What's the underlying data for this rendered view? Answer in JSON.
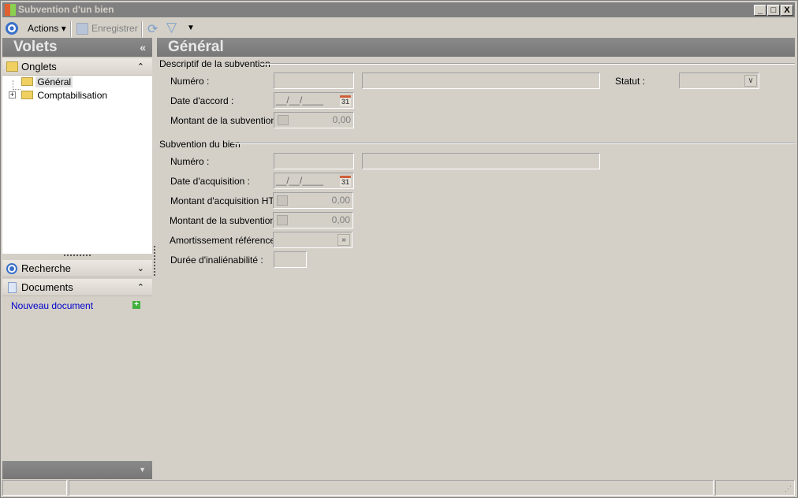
{
  "window": {
    "title": "Subvention d'un bien",
    "min": "_",
    "max": "□",
    "close": "X"
  },
  "toolbar": {
    "actions": "Actions",
    "save": "Enregistrer"
  },
  "left": {
    "title": "Volets",
    "collapse": "«",
    "onglets": "Onglets",
    "tree": [
      {
        "label": "Général",
        "selected": true
      },
      {
        "label": "Comptabilisation",
        "expandable": true
      }
    ],
    "recherche": "Recherche",
    "documents": "Documents",
    "new_doc": "Nouveau document"
  },
  "main": {
    "title": "Général",
    "group1": {
      "title": "Descriptif de la subvention",
      "numero": "Numéro :",
      "statut": "Statut :",
      "date": "Date d'accord :",
      "date_mask": "__/__/____",
      "montant": "Montant de la subvention:",
      "montant_val": "0,00"
    },
    "group2": {
      "title": "Subvention du bien",
      "numero": "Numéro :",
      "date": "Date d'acquisition :",
      "date_mask": "__/__/____",
      "montant_acq": "Montant d'acquisition HT :",
      "montant_acq_val": "0,00",
      "montant": "Montant de la subvention:",
      "montant_val": "0,00",
      "amort": "Amortissement référence :",
      "duree": "Durée d'inaliénabilité :"
    }
  },
  "calendar_day": "31",
  "colors": {
    "accent": "#808080",
    "link": "#0000cc",
    "calendar": "#d0603a"
  }
}
